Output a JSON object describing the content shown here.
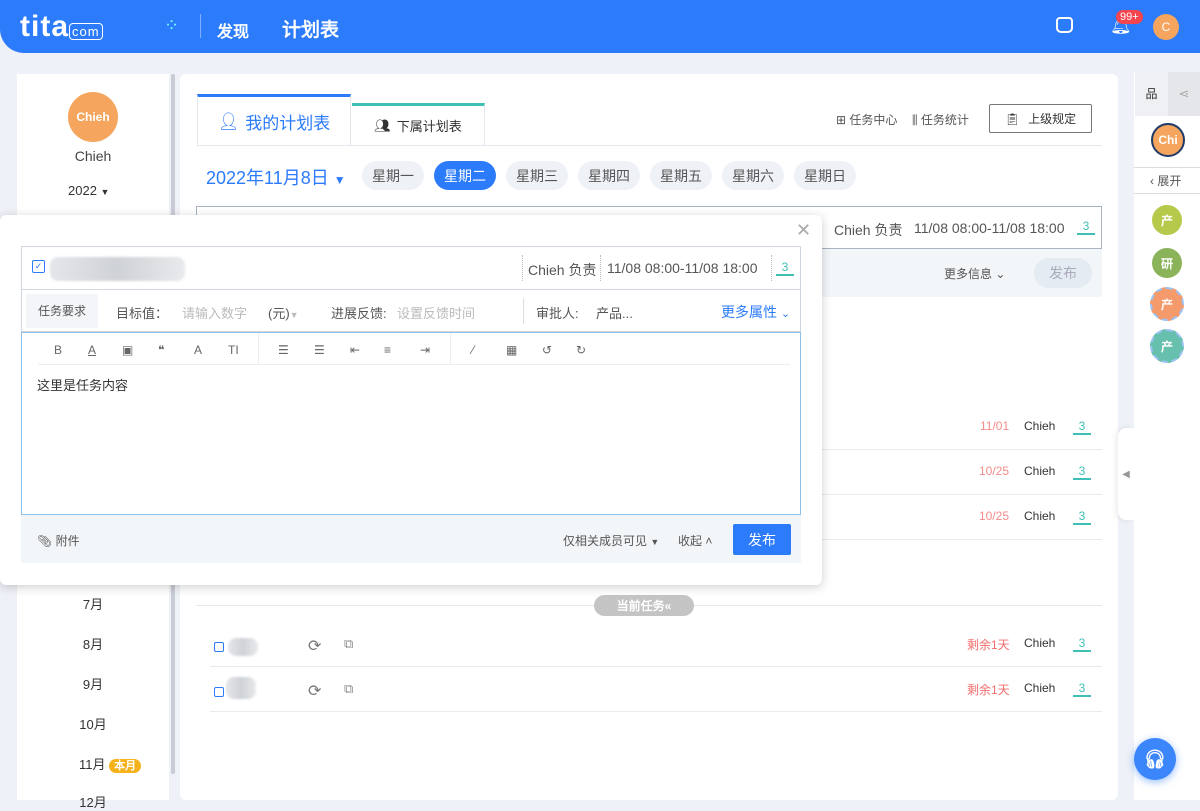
{
  "topbar": {
    "logo": "tita",
    "logo_suffix": "com",
    "nav": [
      "发现",
      "计划表"
    ],
    "badge": "99+",
    "user_initial": "C"
  },
  "colors": {
    "brand": "#2b7bfb",
    "overdue": "#f56c6c",
    "bell": "#3fbfb5",
    "this_month": "#f5b21b"
  },
  "left": {
    "avatar": "Chieh",
    "name": "Chieh",
    "year": "2022",
    "months": [
      "7月",
      "8月",
      "9月",
      "10月",
      "11月",
      "12月"
    ],
    "this_month_badge": "本月"
  },
  "tabs": [
    "我的计划表",
    "下属计划表"
  ],
  "toolbar": {
    "task_center": "任务中心",
    "task_stats": "任务统计",
    "superior_rules": "上级规定"
  },
  "date": "2022年11月8日",
  "weekdays": [
    "星期一",
    "星期二",
    "星期三",
    "星期四",
    "星期五",
    "星期六",
    "星期日"
  ],
  "active_weekday": 1,
  "behind_editor": {
    "owner": "Chieh 负责",
    "time": "11/08 08:00-11/08 18:00",
    "more_info": "更多信息",
    "publish": "发布"
  },
  "tasks_overdue": [
    {
      "date": "11/01",
      "owner": "Chieh"
    },
    {
      "date": "10/25",
      "owner": "Chieh"
    },
    {
      "date": "10/25",
      "owner": "Chieh"
    }
  ],
  "current_label": "当前任务",
  "tasks_current": [
    {
      "due": "剩余1天",
      "owner": "Chieh"
    },
    {
      "due": "剩余1天",
      "owner": "Chieh"
    }
  ],
  "right": {
    "avatar": "Chi",
    "expand": "展开",
    "groups": [
      "产",
      "研",
      "产",
      "产"
    ]
  },
  "popup": {
    "owner": "Chieh 负责",
    "time": "11/08 08:00-11/08 18:00",
    "req_tab": "任务要求",
    "target_label": "目标值：",
    "target_placeholder": "请输入数字",
    "unit": "(元)",
    "feedback_label": "进展反馈:",
    "feedback_placeholder": "设置反馈时间",
    "approver_label": "审批人:",
    "approver": "产品...",
    "more_props": "更多属性",
    "content": "这里是任务内容",
    "attachment": "附件",
    "visibility": "仅相关成员可见",
    "collapse": "收起",
    "publish": "发布"
  }
}
